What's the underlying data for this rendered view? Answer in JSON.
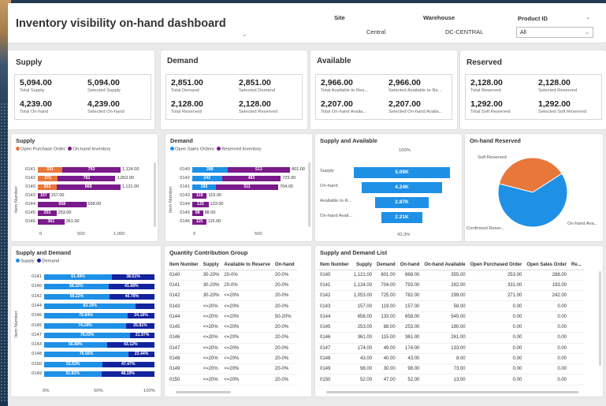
{
  "header": {
    "title": "Inventory visibility on-hand dashboard",
    "filters": [
      {
        "label": "Site",
        "value": "Central"
      },
      {
        "label": "Warehouse",
        "value": "DC-CENTRAL"
      },
      {
        "label": "Product ID",
        "value": "All"
      }
    ]
  },
  "sections": {
    "supply": "Supply",
    "demand": "Demand",
    "available": "Available",
    "reserved": "Reserved"
  },
  "kpis": {
    "supply": [
      {
        "value": "5,094.00",
        "label": "Total Supply"
      },
      {
        "value": "5,094.00",
        "label": "Selected Supply"
      },
      {
        "value": "4,239.00",
        "label": "Total On-hand"
      },
      {
        "value": "4,239.00",
        "label": "Selected On-hand"
      }
    ],
    "demand": [
      {
        "value": "2,851.00",
        "label": "Total Demand"
      },
      {
        "value": "2,851.00",
        "label": "Selected Demand"
      },
      {
        "value": "2,128.00",
        "label": "Total Reserved"
      },
      {
        "value": "2,128.00",
        "label": "Selected Reserved"
      }
    ],
    "available": [
      {
        "value": "2,966.00",
        "label": "Total Available to Res..."
      },
      {
        "value": "2,966.00",
        "label": "Selected Available to Re..."
      },
      {
        "value": "2,207.00",
        "label": "Total On-hand Availa..."
      },
      {
        "value": "2,207.00",
        "label": "Selected On-hand Availa..."
      }
    ],
    "reserved": [
      {
        "value": "2,128.00",
        "label": "Total Reserved"
      },
      {
        "value": "2,128.00",
        "label": "Selected Reserved"
      },
      {
        "value": "1,292.00",
        "label": "Total Soft Reserved"
      },
      {
        "value": "1,292.00",
        "label": "Selected Soft Reserved"
      }
    ]
  },
  "colors": {
    "orange": "#e8773a",
    "purple": "#7b1a8b",
    "blue": "#1e90e6",
    "navy": "#12239e",
    "funnel": "#1e90e6"
  },
  "charts": {
    "supply": {
      "title": "Supply",
      "legend": [
        "Open Purchase Order",
        "On-hand Inventory"
      ],
      "ylabel": "Item Number",
      "ticks": [
        "0",
        "500",
        "1,000"
      ],
      "rows": [
        {
          "id": "0141",
          "a": "331",
          "b": "793",
          "t": "1,124.00"
        },
        {
          "id": "0142",
          "a": "271",
          "b": "782",
          "t": "1,053.00"
        },
        {
          "id": "0140",
          "a": "253",
          "b": "868",
          "t": "1,121.00"
        },
        {
          "id": "0143",
          "a": "",
          "b": "157",
          "t": "157.00"
        },
        {
          "id": "0144",
          "a": "",
          "b": "658",
          "t": "658.00"
        },
        {
          "id": "0145",
          "a": "",
          "b": "253",
          "t": "253.00"
        },
        {
          "id": "0146",
          "a": "",
          "b": "361",
          "t": "361.00"
        }
      ]
    },
    "demand": {
      "title": "Demand",
      "legend": [
        "Open Sales Orders",
        "Reserved Inventory"
      ],
      "ylabel": "Item Number",
      "ticks": [
        "0",
        "500"
      ],
      "rows": [
        {
          "id": "0140",
          "a": "288",
          "b": "513",
          "t": "801.00"
        },
        {
          "id": "0142",
          "a": "242",
          "b": "483",
          "t": "725.00"
        },
        {
          "id": "0141",
          "a": "193",
          "b": "511",
          "t": "704.00"
        },
        {
          "id": "0143",
          "a": "",
          "b": "119",
          "t": "119.00"
        },
        {
          "id": "0144",
          "a": "",
          "b": "133",
          "t": "133.00"
        },
        {
          "id": "0145",
          "a": "",
          "b": "88",
          "t": "88.00"
        },
        {
          "id": "0146",
          "a": "",
          "b": "115",
          "t": "115.00"
        }
      ]
    },
    "funnel": {
      "title": "Supply and Available",
      "top": "100%",
      "bottom": "43.3%",
      "stages": [
        {
          "label": "Supply",
          "value": "5.09K"
        },
        {
          "label": "On-hand",
          "value": "4.24K"
        },
        {
          "label": "Available to R...",
          "value": "2.87K"
        },
        {
          "label": "On-hand Avail...",
          "value": "2.21K"
        }
      ]
    },
    "pie": {
      "title": "On-hand Reserved",
      "slices": [
        {
          "label": "Soft Reserved",
          "value": 1292
        },
        {
          "label": "Confirmed Reser...",
          "value": 0
        },
        {
          "label": "On-hand Ava...",
          "value": 2207
        }
      ]
    },
    "sd": {
      "title": "Supply and Demand",
      "legend": [
        "Supply",
        "Demand"
      ],
      "ylabel": "Item Number",
      "ticks": [
        "0%",
        "50%",
        "100%"
      ],
      "rows": [
        {
          "id": "0141",
          "a": "61.49%",
          "b": "38.51%"
        },
        {
          "id": "0140",
          "a": "58.32%",
          "b": "41.68%"
        },
        {
          "id": "0142",
          "a": "59.22%",
          "b": "40.78%"
        },
        {
          "id": "0144",
          "a": "83.19%",
          "b": ""
        },
        {
          "id": "0146",
          "a": "75.84%",
          "b": "24.16%"
        },
        {
          "id": "0145",
          "a": "74.19%",
          "b": "25.81%"
        },
        {
          "id": "0147",
          "a": "78.03%",
          "b": "21.97%"
        },
        {
          "id": "0143",
          "a": "56.88%",
          "b": "43.12%"
        },
        {
          "id": "0148",
          "a": "76.56%",
          "b": "23.44%"
        },
        {
          "id": "0150",
          "a": "52.53%",
          "b": "47.47%"
        },
        {
          "id": "0149",
          "a": "51.81%",
          "b": "48.19%"
        }
      ]
    }
  },
  "qcg": {
    "title": "Quantity Contribution Group",
    "columns": [
      "Item Number",
      "Supply",
      "Available to Reserve",
      "On-hand"
    ],
    "rows": [
      [
        "0140",
        "30-20%",
        "20-0%",
        "20-0%"
      ],
      [
        "0141",
        "30-20%",
        "20-0%",
        "20-0%"
      ],
      [
        "0142",
        "30-20%",
        "<=20%",
        "20-0%"
      ],
      [
        "0143",
        "<=20%",
        "<=20%",
        "20-0%"
      ],
      [
        "0144",
        "<=20%",
        "<=20%",
        "50-20%"
      ],
      [
        "0145",
        "<=20%",
        "<=20%",
        "20-0%"
      ],
      [
        "0146",
        "<=20%",
        "<=20%",
        "20-0%"
      ],
      [
        "0147",
        "<=20%",
        "<=20%",
        "20-0%"
      ],
      [
        "0148",
        "<=20%",
        "<=20%",
        "20-0%"
      ],
      [
        "0149",
        "<=20%",
        "<=20%",
        "20-0%"
      ],
      [
        "0150",
        "<=20%",
        "<=20%",
        "20-0%"
      ]
    ]
  },
  "sdl": {
    "title": "Supply and Demand List",
    "columns": [
      "Item Number",
      "Supply",
      "Demand",
      "On-hand",
      "On-hand Available",
      "Open Purchased Order",
      "Open Sales Order",
      "Re..."
    ],
    "rows": [
      [
        "0140",
        "1,121.00",
        "801.00",
        "868.00",
        "355.00",
        "253.00",
        "288.00",
        ""
      ],
      [
        "0141",
        "1,124.00",
        "704.00",
        "793.00",
        "282.00",
        "331.00",
        "193.00",
        ""
      ],
      [
        "0142",
        "1,053.00",
        "725.00",
        "782.00",
        "299.00",
        "271.00",
        "242.00",
        ""
      ],
      [
        "0143",
        "157.00",
        "119.00",
        "157.00",
        "58.00",
        "0.00",
        "0.00",
        ""
      ],
      [
        "0144",
        "658.00",
        "133.00",
        "658.00",
        "545.00",
        "0.00",
        "0.00",
        ""
      ],
      [
        "0145",
        "253.00",
        "88.00",
        "253.00",
        "180.00",
        "0.00",
        "0.00",
        ""
      ],
      [
        "0146",
        "361.00",
        "115.00",
        "361.00",
        "261.00",
        "0.00",
        "0.00",
        ""
      ],
      [
        "0147",
        "174.00",
        "49.00",
        "174.00",
        "133.00",
        "0.00",
        "0.00",
        ""
      ],
      [
        "0148",
        "43.00",
        "40.00",
        "43.00",
        "8.00",
        "0.00",
        "0.00",
        ""
      ],
      [
        "0149",
        "98.00",
        "30.00",
        "98.00",
        "73.00",
        "0.00",
        "0.00",
        ""
      ],
      [
        "0150",
        "52.00",
        "47.00",
        "52.00",
        "13.00",
        "0.00",
        "0.00",
        ""
      ]
    ]
  }
}
